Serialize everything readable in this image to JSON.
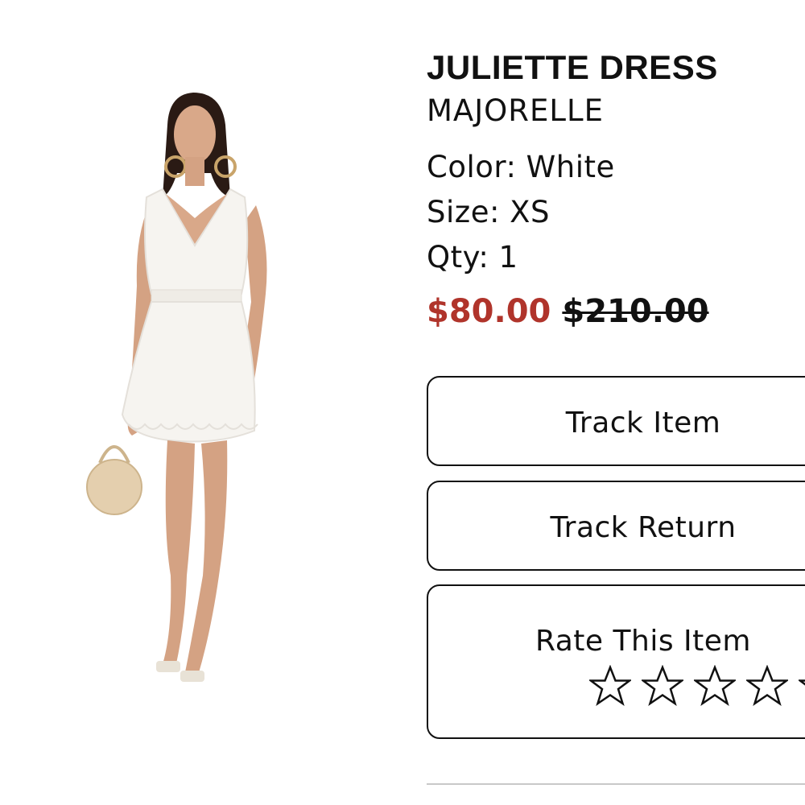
{
  "product": {
    "name": "JULIETTE DRESS",
    "brand": "MAJORELLE",
    "color_label": "Color: White",
    "size_label": "Size: XS",
    "qty_label": "Qty: 1",
    "sale_price": "$80.00",
    "original_price": "$210.00",
    "sale_color": "#b0342b"
  },
  "actions": {
    "track_item": "Track Item",
    "track_return": "Track Return",
    "rate_label": "Rate This Item",
    "rating": {
      "value": 0,
      "max": 5,
      "icon": "star-outline-icon"
    }
  }
}
